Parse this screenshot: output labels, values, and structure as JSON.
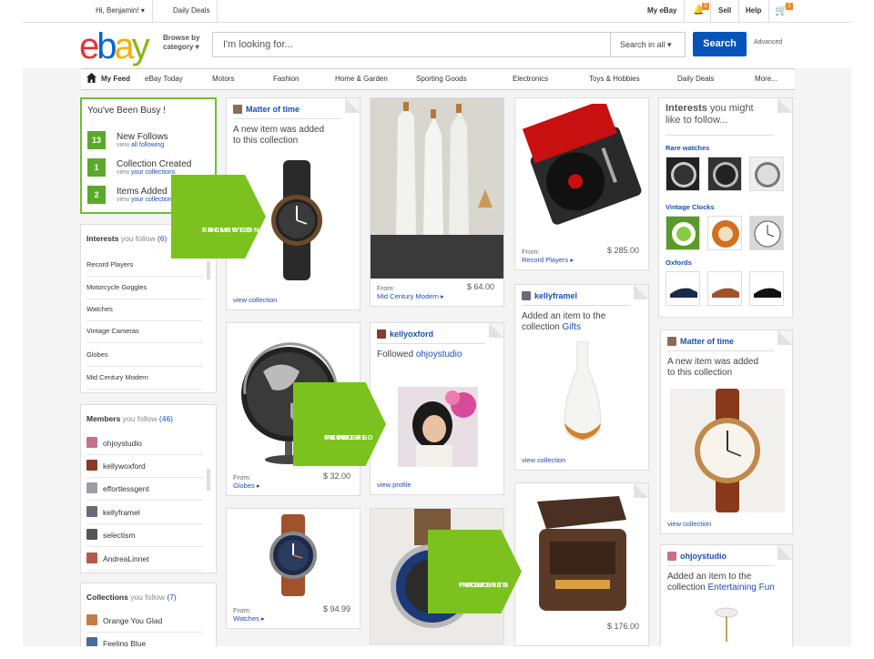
{
  "topbar": {
    "greeting": "Hi, Benjamin!",
    "daily_deals": "Daily Deals",
    "my_ebay": "My eBay",
    "notif_count": "5",
    "sell": "Sell",
    "help": "Help",
    "cart_count": "2"
  },
  "header": {
    "logo_letters": [
      "e",
      "b",
      "a",
      "y"
    ],
    "browse_line1": "Browse by",
    "browse_line2": "category",
    "search_placeholder": "I'm looking for...",
    "search_scope": "Search in all",
    "search_button": "Search",
    "advanced": "Advanced"
  },
  "nav": [
    "My Feed",
    "eBay Today",
    "Motors",
    "Fashion",
    "Home & Garden",
    "Sporting Goods",
    "Electronics",
    "Toys & Hobbies",
    "Daily Deals",
    "More..."
  ],
  "busy": {
    "title": "You've Been Busy !",
    "rows": [
      {
        "num": "13",
        "label": "New Follows",
        "sub_pre": "view ",
        "sub_link": "all following"
      },
      {
        "num": "1",
        "label": "Collection Created",
        "sub_pre": "view ",
        "sub_link": "your collections"
      },
      {
        "num": "2",
        "label": "Items Added",
        "sub_pre": "view ",
        "sub_link": "your collections"
      }
    ]
  },
  "interests": {
    "title": "Interests",
    "sub": "you follow",
    "count": "(6)",
    "items": [
      "Record Players",
      "Motorcycle Goggles",
      "Watches",
      "Vintage Cameras",
      "Globes",
      "Mid Century Modern"
    ]
  },
  "members": {
    "title": "Members",
    "sub": "you follow",
    "count": "(46)",
    "items": [
      "ohjoystudio",
      "kellywoxford",
      "effortlessgent",
      "kellyframel",
      "selectism",
      "AndreaLinnet"
    ]
  },
  "collections": {
    "title": "Collections",
    "sub": "you follow",
    "count": "(7)",
    "items": [
      "Orange You Glad",
      "Feeling Blue"
    ]
  },
  "arrows": {
    "a1": [
      "FROM",
      "FOLLOWED",
      "COLLECTIONS"
    ],
    "a2": [
      "FROM",
      "FOLLOWED",
      "MEMBERS"
    ],
    "a3": [
      "FROM",
      "FOLLOWED",
      "INTERESTS"
    ]
  },
  "cards": {
    "matter1": {
      "user": "Matter of time",
      "msg1": "A new item was added",
      "msg2": "to this collection",
      "foot": "view collection"
    },
    "bottles": {
      "from": "From:",
      "link": "Mid Century Modern",
      "price": "$ 64.00"
    },
    "turntable": {
      "from": "From:",
      "link": "Record Players",
      "price": "$ 285.00"
    },
    "globe": {
      "from": "From:",
      "link": "Globes",
      "price": "$ 32.00"
    },
    "kellyoxford": {
      "user": "kellyoxford",
      "msg": "Followed",
      "link": "ohjoystudio",
      "foot": "view profile"
    },
    "kellyframel": {
      "user": "kellyframel",
      "msg1": "Added an item to the",
      "msg2": "collection",
      "link": "Gifts",
      "foot": "view collection"
    },
    "watch2": {
      "from": "From:",
      "link": "Watches",
      "price": "$ 94.99"
    },
    "radio": {
      "from": "",
      "price": "$ 176.00"
    },
    "matter2": {
      "user": "Matter of time",
      "msg1": "A new item was added",
      "msg2": "to this collection",
      "foot": "view collection"
    },
    "ohjoy": {
      "user": "ohjoystudio",
      "msg1": "Added an item to the",
      "msg2": "collection",
      "link": "Entertaining Fun"
    }
  },
  "suggest": {
    "title1": "Interests",
    "title2": "you might",
    "title3": "like to follow...",
    "groups": [
      "Rare watches",
      "Vintage Clocks",
      "Oxfords"
    ]
  }
}
